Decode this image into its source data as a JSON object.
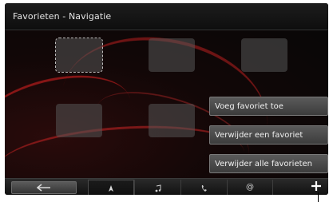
{
  "header": {
    "title": "Favorieten - Navigatie"
  },
  "favorites": {
    "tiles": [
      {
        "row": 1,
        "col": 1,
        "state": "selected"
      },
      {
        "row": 1,
        "col": 2,
        "state": "empty"
      },
      {
        "row": 1,
        "col": 3,
        "state": "empty"
      },
      {
        "row": 2,
        "col": 1,
        "state": "empty"
      },
      {
        "row": 2,
        "col": 2,
        "state": "empty"
      }
    ]
  },
  "menu": {
    "items": [
      {
        "label": "Voeg favoriet toe"
      },
      {
        "label": "Verwijder een favoriet"
      },
      {
        "label": "Verwijder alle favorieten"
      }
    ]
  },
  "bottom_bar": {
    "back_icon": "arrow-left-icon",
    "tabs": [
      {
        "icon": "navigation-icon",
        "active": true
      },
      {
        "icon": "music-note-icon",
        "active": false
      },
      {
        "icon": "phone-icon",
        "active": false
      },
      {
        "icon": "at-sign-icon",
        "active": false
      }
    ],
    "plus_icon": "plus-icon"
  },
  "colors": {
    "accent": "#d01818",
    "menu_bg": "#4a4a4a"
  }
}
